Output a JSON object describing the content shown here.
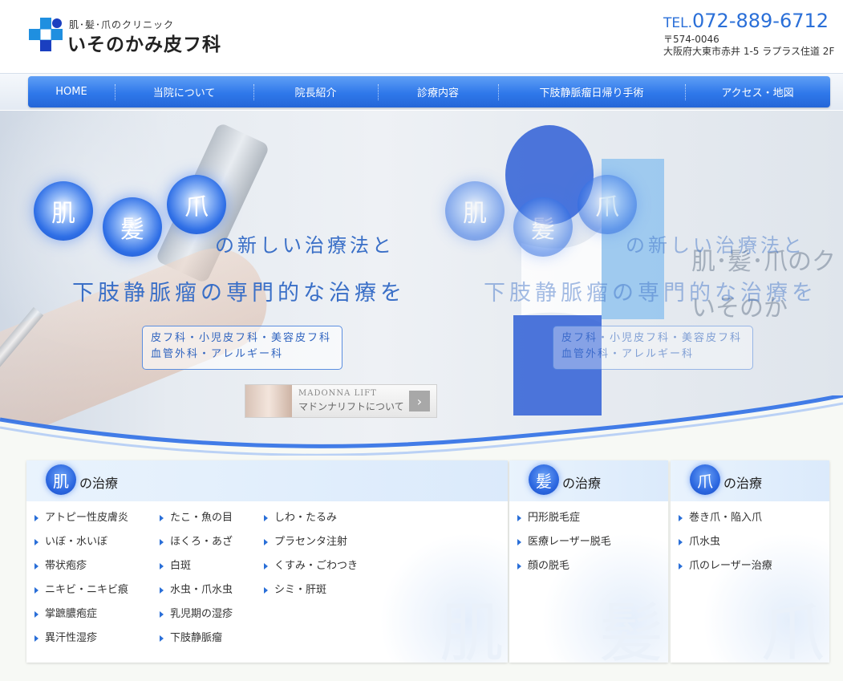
{
  "header": {
    "logo_sub": "肌･髪･爪のクリニック",
    "logo_name": "いそのかみ皮フ科",
    "tel_label": "TEL.",
    "tel_number": "072-889-6712",
    "zip": "〒574-0046",
    "address": "大阪府大東市赤井 1-5 ラプラス住道 2F"
  },
  "nav": {
    "items": [
      {
        "label": "HOME",
        "width": 108
      },
      {
        "label": "当院について",
        "width": 173
      },
      {
        "label": "院長紹介",
        "width": 155
      },
      {
        "label": "診療内容",
        "width": 150
      },
      {
        "label": "下肢静脈瘤日帰り手術",
        "width": 233
      },
      {
        "label": "アクセス・地図",
        "width": 181
      }
    ]
  },
  "hero": {
    "bubble1": "肌",
    "bubble2": "髪",
    "bubble3": "爪",
    "line1": "の新しい治療法と",
    "line2": "下肢静脈瘤の専門的な治療を",
    "spec1": "皮フ科・小児皮フ科・美容皮フ科",
    "spec2": "血管外科・アレルギー科",
    "madonna_en": "MADONNA LIFT",
    "madonna_ja": "マドンナリフトについて",
    "madonna_arrow": "›",
    "signage": "肌･髪･爪のク いそのか"
  },
  "panels": {
    "suffix": "の治療",
    "skin": {
      "label": "肌",
      "col1": [
        "アトピー性皮膚炎",
        "いぼ・水いぼ",
        "帯状疱疹",
        "ニキビ・ニキビ痕",
        "掌蹠膿疱症",
        "異汗性湿疹"
      ],
      "col2": [
        "たこ・魚の目",
        "ほくろ・あざ",
        "白斑",
        "水虫・爪水虫",
        "乳児期の湿疹",
        "下肢静脈瘤"
      ],
      "col3": [
        "しわ・たるみ",
        "プラセンタ注射",
        "くすみ・ごわつき",
        "シミ・肝斑"
      ]
    },
    "hair": {
      "label": "髪",
      "col1": [
        "円形脱毛症",
        "医療レーザー脱毛",
        "顔の脱毛"
      ]
    },
    "nail": {
      "label": "爪",
      "col1": [
        "巻き爪・陥入爪",
        "爪水虫",
        "爪のレーザー治療"
      ]
    }
  },
  "colors": {
    "accent": "#2f78ea",
    "text_blue": "#3a6fc7",
    "tel_blue": "#2a6fd8"
  }
}
